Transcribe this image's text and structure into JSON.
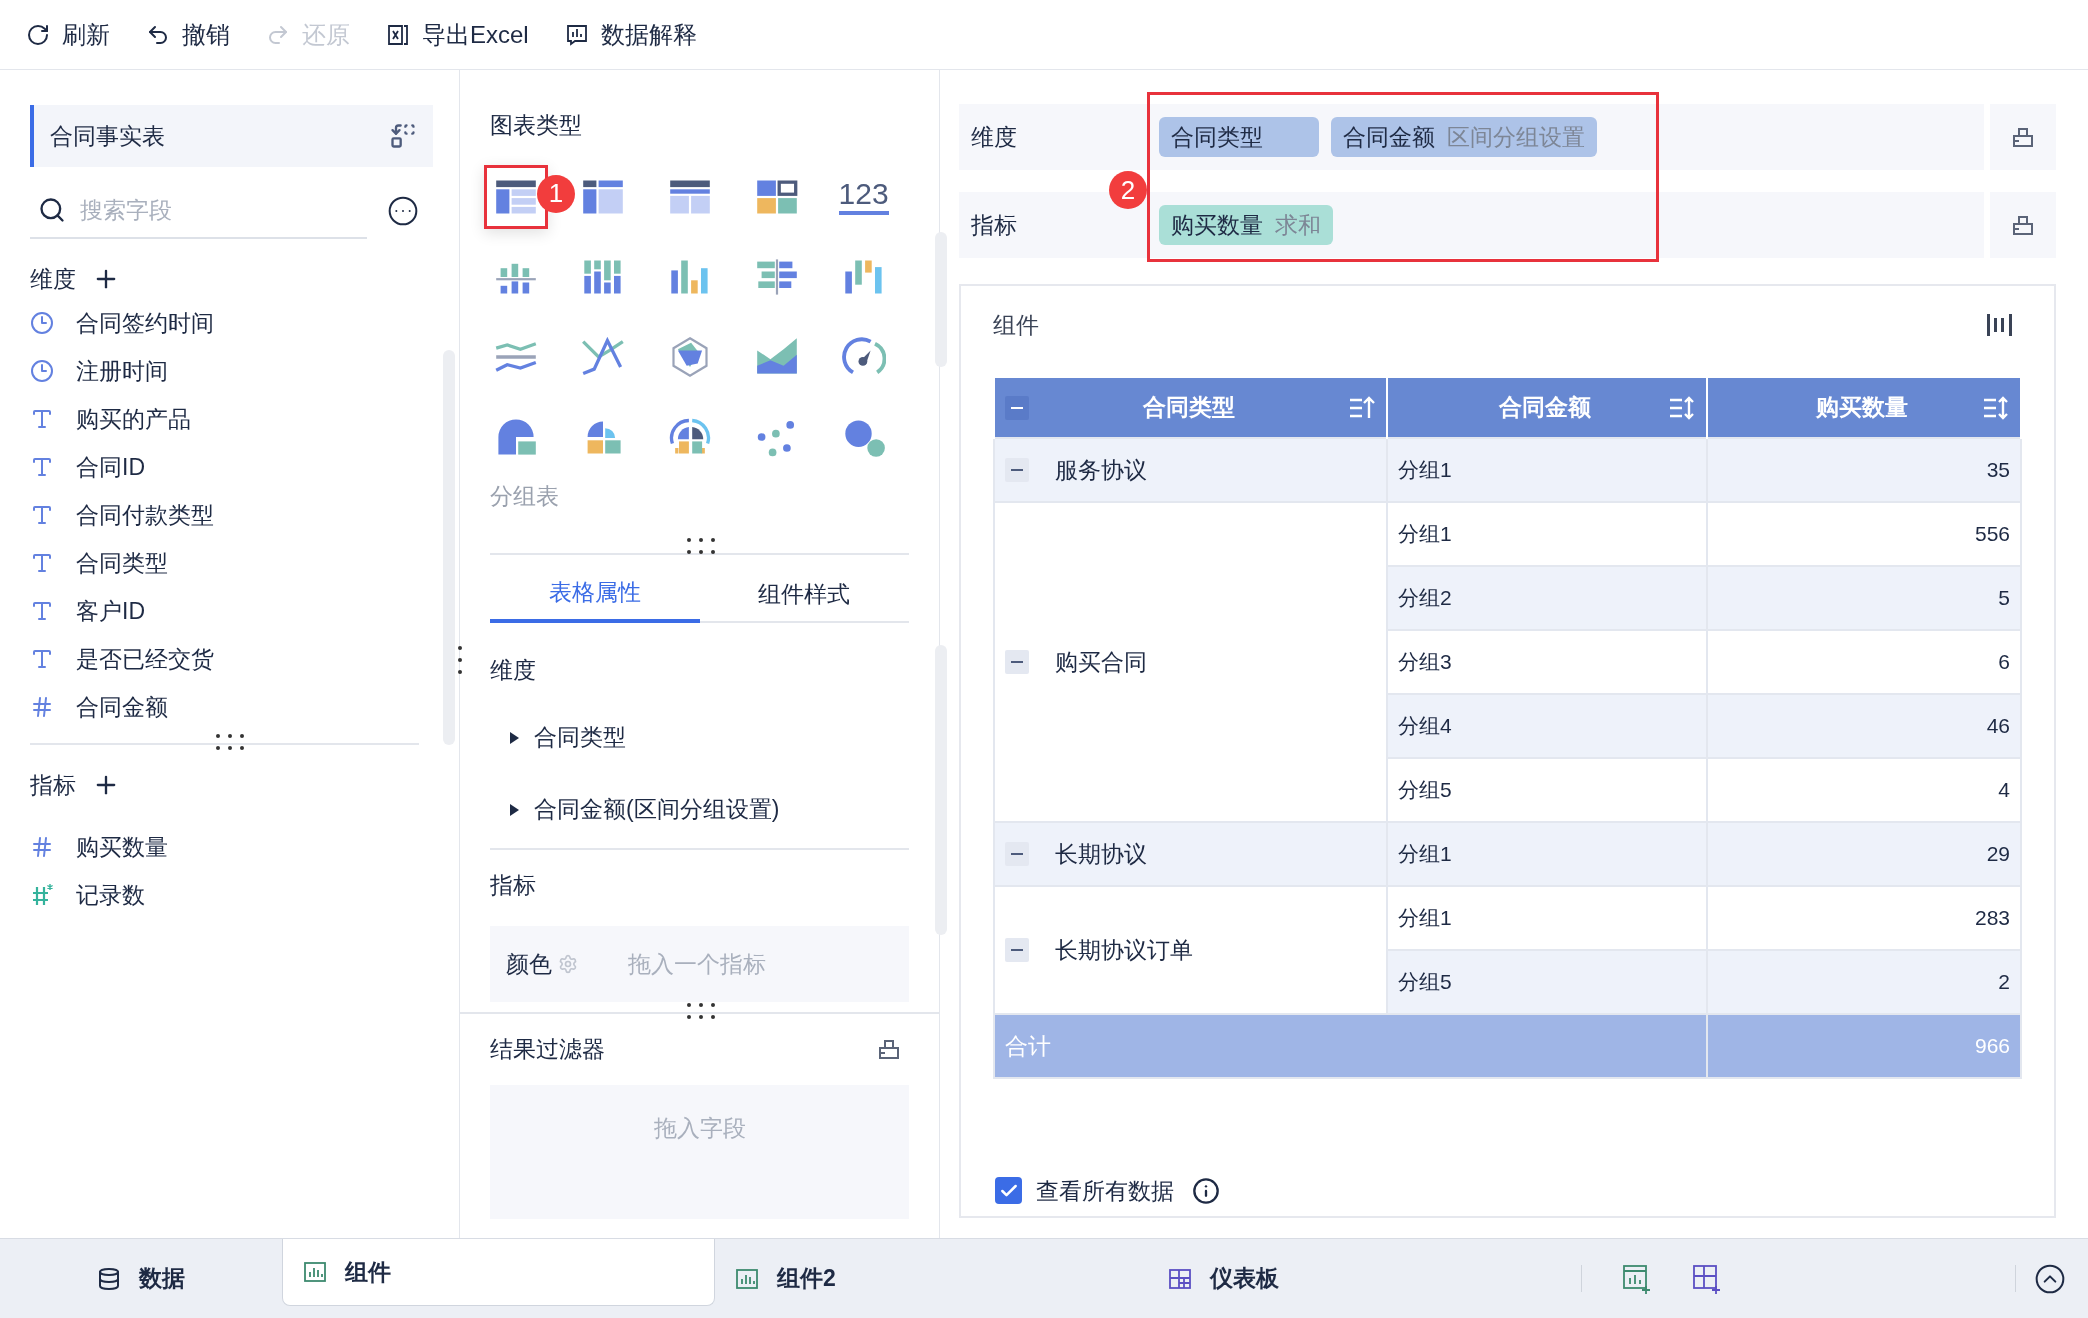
{
  "toolbar": [
    {
      "kind": "refresh",
      "label": "刷新",
      "disabled": false
    },
    {
      "kind": "undo",
      "label": "撤销",
      "disabled": false
    },
    {
      "kind": "redo",
      "label": "还原",
      "disabled": true
    },
    {
      "kind": "excel",
      "label": "导出Excel",
      "disabled": false
    },
    {
      "kind": "explain",
      "label": "数据解释",
      "disabled": false
    }
  ],
  "data_panel": {
    "title": "合同事实表",
    "search": {
      "placeholder": "搜索字段"
    },
    "dimensions": {
      "title": "维度",
      "fields": [
        {
          "kind": "date",
          "label": "合同签约时间"
        },
        {
          "kind": "date",
          "label": "注册时间"
        },
        {
          "kind": "text",
          "label": "购买的产品"
        },
        {
          "kind": "text",
          "label": "合同ID"
        },
        {
          "kind": "text",
          "label": "合同付款类型"
        },
        {
          "kind": "text",
          "label": "合同类型"
        },
        {
          "kind": "text",
          "label": "客户ID"
        },
        {
          "kind": "text",
          "label": "是否已经交货"
        },
        {
          "kind": "number",
          "label": "合同金额"
        }
      ]
    },
    "metrics": {
      "title": "指标",
      "fields": [
        {
          "kind": "number",
          "label": "购买数量"
        },
        {
          "kind": "count",
          "label": "记录数"
        }
      ]
    }
  },
  "chart_panel": {
    "title": "图表类型",
    "badge": "1",
    "types": [
      {
        "kind": "grouptable",
        "selected": true
      },
      {
        "kind": "crosstable",
        "selected": false
      },
      {
        "kind": "detailtable",
        "selected": false
      },
      {
        "kind": "multi",
        "selected": false
      },
      {
        "kind": "kpi",
        "label": "123",
        "selected": false
      },
      {
        "kind": "stackedbar",
        "selected": false
      },
      {
        "kind": "groupbar",
        "selected": false
      },
      {
        "kind": "bar",
        "selected": false
      },
      {
        "kind": "butterfly",
        "selected": false
      },
      {
        "kind": "waterfall",
        "selected": false
      },
      {
        "kind": "range",
        "selected": false
      },
      {
        "kind": "line",
        "selected": false
      },
      {
        "kind": "radar",
        "selected": false
      },
      {
        "kind": "area",
        "selected": false
      },
      {
        "kind": "gauge",
        "selected": false
      },
      {
        "kind": "pie",
        "selected": false
      },
      {
        "kind": "rose",
        "selected": false
      },
      {
        "kind": "sunburst",
        "selected": false
      },
      {
        "kind": "scatter",
        "selected": false
      },
      {
        "kind": "bubble",
        "selected": false
      }
    ],
    "type_name": "分组表",
    "tabs": [
      {
        "label": "表格属性",
        "selected": true
      },
      {
        "label": "组件样式",
        "selected": false
      }
    ],
    "dimension_title": "维度",
    "dimension_items": [
      {
        "label": "合同类型",
        "expanded": false
      },
      {
        "label": "合同金额(区间分组设置)",
        "expanded": false
      }
    ],
    "metric_title": "指标",
    "color": {
      "label": "颜色",
      "hint": "拖入一个指标"
    },
    "filter": {
      "title": "结果过滤器",
      "hint": "拖入字段"
    }
  },
  "shelf": {
    "badge": "2",
    "rows": [
      {
        "kind": "dimension",
        "label": "维度",
        "pills": [
          {
            "name": "合同类型"
          },
          {
            "name": "合同金额",
            "note": "区间分组设置"
          }
        ]
      },
      {
        "kind": "metric",
        "label": "指标",
        "pills": [
          {
            "name": "购买数量",
            "note": "求和"
          }
        ]
      }
    ]
  },
  "widget": {
    "title": "组件",
    "table": {
      "columns": [
        {
          "label": "合同类型",
          "ascending": true
        },
        {
          "label": "合同金额",
          "ascending": false
        },
        {
          "label": "购买数量",
          "ascending": false
        }
      ],
      "groups": [
        {
          "name": "服务协议",
          "expanded": true,
          "rows": [
            {
              "bucket": "分组1",
              "value": "35"
            }
          ]
        },
        {
          "name": "购买合同",
          "expanded": true,
          "rows": [
            {
              "bucket": "分组1",
              "value": "556"
            },
            {
              "bucket": "分组2",
              "value": "5"
            },
            {
              "bucket": "分组3",
              "value": "6"
            },
            {
              "bucket": "分组4",
              "value": "46"
            },
            {
              "bucket": "分组5",
              "value": "4"
            }
          ]
        },
        {
          "name": "长期协议",
          "expanded": true,
          "rows": [
            {
              "bucket": "分组1",
              "value": "29"
            }
          ]
        },
        {
          "name": "长期协议订单",
          "expanded": true,
          "rows": [
            {
              "bucket": "分组1",
              "value": "283"
            },
            {
              "bucket": "分组5",
              "value": "2"
            }
          ]
        }
      ],
      "total": {
        "label": "合计",
        "value": "966"
      }
    },
    "show_all": {
      "label": "查看所有数据",
      "checked": true
    }
  },
  "bottom_tabs": [
    {
      "kind": "data",
      "label": "数据",
      "selected": false
    },
    {
      "kind": "chart",
      "label": "组件",
      "selected": true
    },
    {
      "kind": "chart",
      "label": "组件2",
      "selected": false
    },
    {
      "kind": "dashboard",
      "label": "仪表板",
      "selected": false
    }
  ]
}
